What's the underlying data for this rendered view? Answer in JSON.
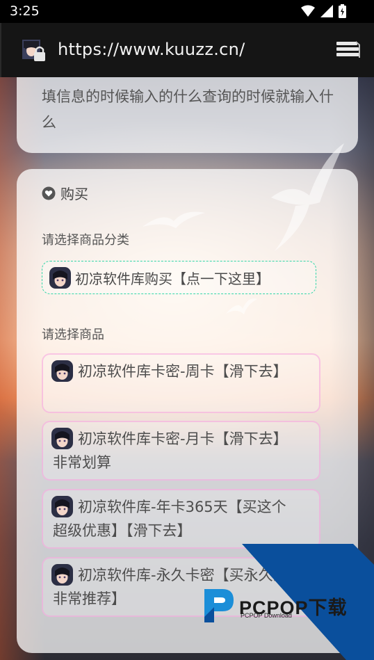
{
  "status_bar": {
    "time": "3:25"
  },
  "browser": {
    "url": "https://www.kuuzz.cn/"
  },
  "top_card": {
    "text": "填信息的时候输入的什么查询的时候就输入什么"
  },
  "buy_card": {
    "title": "购买",
    "category_label": "请选择商品分类",
    "category_selected": "初凉软件库购买【点一下这里】",
    "product_label": "请选择商品",
    "products": [
      "初凉软件库卡密-周卡【滑下去】",
      "初凉软件库卡密-月卡【滑下去】非常划算",
      "初凉软件库-年卡365天【买这个超级优惠】【滑下去】",
      "初凉软件库-永久卡密【买永久的非常推荐】"
    ]
  },
  "watermark": {
    "brand": "PCPOP下载",
    "sub": "PCPOP Download"
  },
  "colors": {
    "category_border": "#33d6a8",
    "product_border": "#f5a0dc",
    "watermark_blue": "#0a4f9c"
  }
}
